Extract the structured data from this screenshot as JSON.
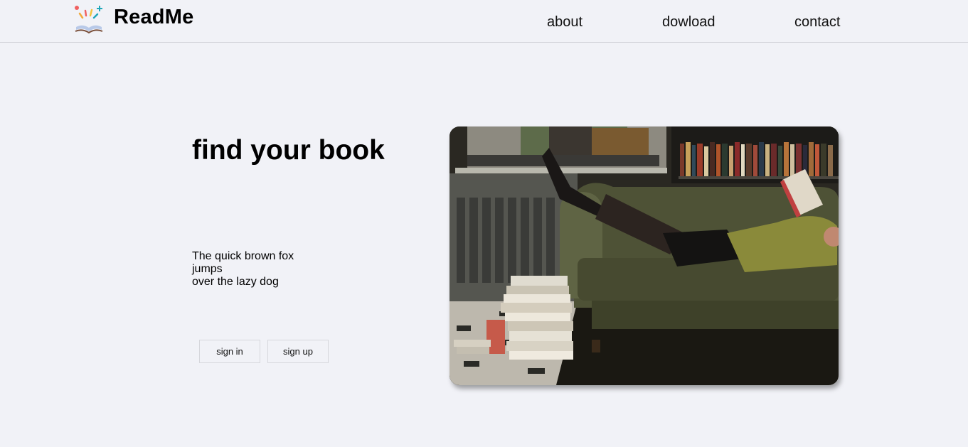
{
  "header": {
    "brand": "ReadMe",
    "logo_icon": "open-book-sparkle-icon",
    "nav": [
      {
        "label": "about"
      },
      {
        "label": "dowload"
      },
      {
        "label": "contact"
      }
    ]
  },
  "hero": {
    "title": "find your book",
    "tagline_lines": [
      "The quick brown fox",
      "jumps",
      "over the lazy dog"
    ],
    "buttons": {
      "sign_in": "sign in",
      "sign_up": "sign up"
    },
    "image_icon": "woman-reading-on-sofa-photo"
  },
  "colors": {
    "background": "#f1f2f7",
    "text": "#000000",
    "divider": "#cfd0d6"
  }
}
